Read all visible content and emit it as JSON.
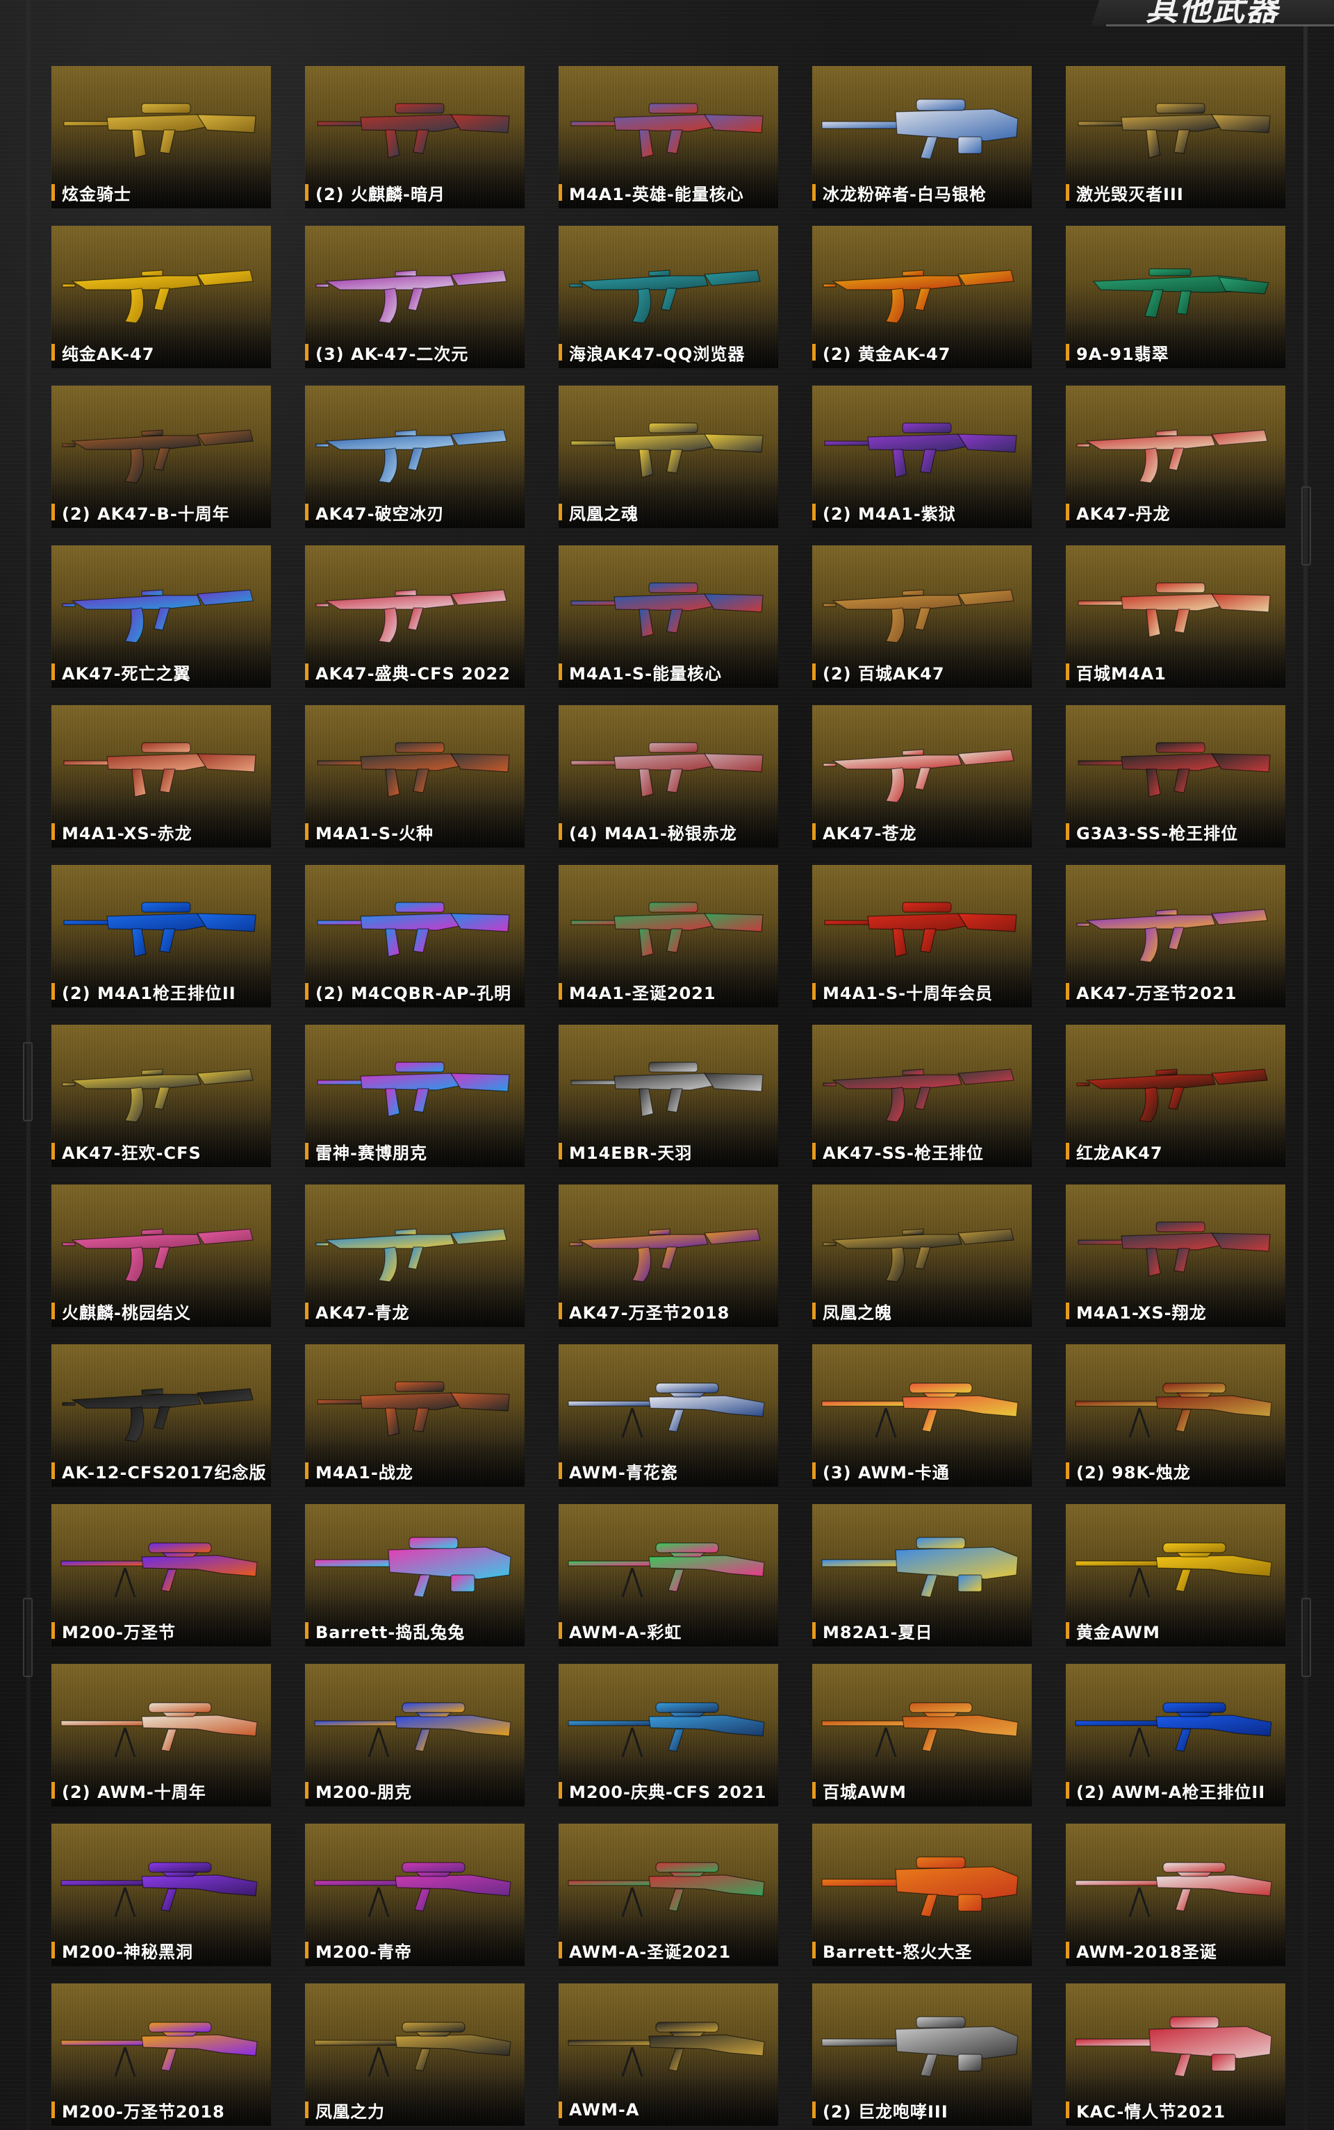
{
  "header": {
    "title": "其他武器"
  },
  "weapons": [
    {
      "name": "炫金骑士",
      "kind": "rifle",
      "colors": [
        "#d8b23a",
        "#8a6a18"
      ]
    },
    {
      "name": "(2) 火麒麟-暗月",
      "kind": "rifle",
      "colors": [
        "#b0332b",
        "#3a3a48"
      ]
    },
    {
      "name": "M4A1-英雄-能量核心",
      "kind": "rifle",
      "colors": [
        "#6a5aa8",
        "#c0392b"
      ]
    },
    {
      "name": "冰龙粉碎者-白马银枪",
      "kind": "heavy",
      "colors": [
        "#d8dce8",
        "#3a6ab0"
      ]
    },
    {
      "name": "激光毁灭者III",
      "kind": "rifle",
      "colors": [
        "#c8a040",
        "#2a2a2a"
      ]
    },
    {
      "name": "纯金AK-47",
      "kind": "ak",
      "colors": [
        "#f2c318",
        "#b88a08"
      ]
    },
    {
      "name": "(3) AK-47-二次元",
      "kind": "ak",
      "colors": [
        "#a03aa8",
        "#d8c0e0"
      ]
    },
    {
      "name": "海浪AK47-QQ浏览器",
      "kind": "ak",
      "colors": [
        "#2a9aa0",
        "#1a5a60"
      ]
    },
    {
      "name": "(2) 黄金AK-47",
      "kind": "ak",
      "colors": [
        "#e8a010",
        "#c04010"
      ]
    },
    {
      "name": "9A-91翡翠",
      "kind": "smg",
      "colors": [
        "#2aa070",
        "#0e5a3a"
      ]
    },
    {
      "name": "(2) AK47-B-十周年",
      "kind": "ak",
      "colors": [
        "#a05a2a",
        "#2a2a2a"
      ]
    },
    {
      "name": "AK47-破空冰刃",
      "kind": "ak",
      "colors": [
        "#3a6ab0",
        "#a0c8e8"
      ]
    },
    {
      "name": "凤凰之魂",
      "kind": "rifle",
      "colors": [
        "#e8c83a",
        "#3a3a3a"
      ]
    },
    {
      "name": "(2) M4A1-紫狱",
      "kind": "rifle",
      "colors": [
        "#8a3ac8",
        "#3a2a6a"
      ]
    },
    {
      "name": "AK47-丹龙",
      "kind": "ak",
      "colors": [
        "#c83a3a",
        "#e8d0b0"
      ]
    },
    {
      "name": "AK47-死亡之翼",
      "kind": "ak",
      "colors": [
        "#6a3ac8",
        "#2a9ad8"
      ]
    },
    {
      "name": "AK47-盛典-CFS 2022",
      "kind": "ak",
      "colors": [
        "#c83a4a",
        "#e8c8d0"
      ]
    },
    {
      "name": "M4A1-S-能量核心",
      "kind": "rifle",
      "colors": [
        "#2a5ab0",
        "#c83a3a"
      ]
    },
    {
      "name": "(2) 百城AK47",
      "kind": "ak",
      "colors": [
        "#c8903a",
        "#8a5a2a"
      ]
    },
    {
      "name": "百城M4A1",
      "kind": "rifle",
      "colors": [
        "#c83a2a",
        "#e8d0a0"
      ]
    },
    {
      "name": "M4A1-XS-赤龙",
      "kind": "rifle",
      "colors": [
        "#a03a2a",
        "#e8a07a"
      ]
    },
    {
      "name": "M4A1-S-火种",
      "kind": "rifle",
      "colors": [
        "#3a3a3a",
        "#c85a2a"
      ]
    },
    {
      "name": "(4) M4A1-秘银赤龙",
      "kind": "rifle",
      "colors": [
        "#c8a0a8",
        "#a03a3a"
      ]
    },
    {
      "name": "AK47-苍龙",
      "kind": "ak",
      "colors": [
        "#e8e0d0",
        "#c83a3a"
      ]
    },
    {
      "name": "G3A3-SS-枪王排位",
      "kind": "rifle",
      "colors": [
        "#2a2a2a",
        "#c83a3a"
      ]
    },
    {
      "name": "(2) M4A1枪王排位II",
      "kind": "rifle",
      "colors": [
        "#1a6ae8",
        "#0a3aa0"
      ]
    },
    {
      "name": "(2) M4CQBR-AP-孔明",
      "kind": "rifle",
      "colors": [
        "#2a8ae8",
        "#c83ac8"
      ]
    },
    {
      "name": "M4A1-圣诞2021",
      "kind": "rifle",
      "colors": [
        "#3aa05a",
        "#c83a3a"
      ]
    },
    {
      "name": "M4A1-S-十周年会员",
      "kind": "rifle",
      "colors": [
        "#d82a1a",
        "#8a1a10"
      ]
    },
    {
      "name": "AK47-万圣节2021",
      "kind": "ak",
      "colors": [
        "#8a3ac8",
        "#e8a03a"
      ]
    },
    {
      "name": "AK47-狂欢-CFS",
      "kind": "ak",
      "colors": [
        "#e8c83a",
        "#3a3a3a"
      ]
    },
    {
      "name": "雷神-赛博朋克",
      "kind": "rifle",
      "colors": [
        "#c83ac8",
        "#2a9ae8"
      ]
    },
    {
      "name": "M14EBR-天羽",
      "kind": "rifle",
      "colors": [
        "#3a3a3a",
        "#c8c8c8"
      ]
    },
    {
      "name": "AK47-SS-枪王排位",
      "kind": "ak",
      "colors": [
        "#3a3a3a",
        "#c83a4a"
      ]
    },
    {
      "name": "红龙AK47",
      "kind": "ak",
      "colors": [
        "#c82a1a",
        "#3a1a10"
      ]
    },
    {
      "name": "火麒麟-桃园结义",
      "kind": "ak",
      "colors": [
        "#e85aa0",
        "#a03a6a"
      ]
    },
    {
      "name": "AK47-青龙",
      "kind": "ak",
      "colors": [
        "#2a8ad8",
        "#e8c83a"
      ]
    },
    {
      "name": "AK47-万圣节2018",
      "kind": "ak",
      "colors": [
        "#e89a1a",
        "#6a2aa0"
      ]
    },
    {
      "name": "凤凰之魄",
      "kind": "ak",
      "colors": [
        "#c8a03a",
        "#2a2a2a"
      ]
    },
    {
      "name": "M4A1-XS-翔龙",
      "kind": "rifle",
      "colors": [
        "#3a3a4a",
        "#c83a3a"
      ]
    },
    {
      "name": "AK-12-CFS2017纪念版",
      "kind": "ak",
      "colors": [
        "#1a1a1a",
        "#3a3a3a"
      ]
    },
    {
      "name": "M4A1-战龙",
      "kind": "rifle",
      "colors": [
        "#c85a2a",
        "#2a2a2a"
      ]
    },
    {
      "name": "AWM-青花瓷",
      "kind": "sniper",
      "colors": [
        "#e8e8f0",
        "#2a4a8a"
      ]
    },
    {
      "name": "(3) AWM-卡通",
      "kind": "sniper",
      "colors": [
        "#e85a3a",
        "#e8c83a"
      ]
    },
    {
      "name": "(2) 98K-烛龙",
      "kind": "sniper",
      "colors": [
        "#8a2a1a",
        "#c8a03a"
      ]
    },
    {
      "name": "M200-万圣节",
      "kind": "sniper",
      "colors": [
        "#6a2ae8",
        "#e85a1a"
      ]
    },
    {
      "name": "Barrett-捣乱兔兔",
      "kind": "heavy",
      "colors": [
        "#e83ab0",
        "#3ac8e8"
      ]
    },
    {
      "name": "AWM-A-彩虹",
      "kind": "sniper",
      "colors": [
        "#3ac85a",
        "#e83a8a"
      ]
    },
    {
      "name": "M82A1-夏日",
      "kind": "heavy",
      "colors": [
        "#3a8ae8",
        "#e8c83a"
      ]
    },
    {
      "name": "黄金AWM",
      "kind": "sniper",
      "colors": [
        "#f2c318",
        "#a07a08"
      ]
    },
    {
      "name": "(2) AWM-十周年",
      "kind": "sniper",
      "colors": [
        "#e8e0d0",
        "#c85a2a"
      ]
    },
    {
      "name": "M200-朋克",
      "kind": "sniper",
      "colors": [
        "#2a4ae8",
        "#e8a01a"
      ]
    },
    {
      "name": "M200-庆典-CFS 2021",
      "kind": "sniper",
      "colors": [
        "#3a9ad8",
        "#1a3a6a"
      ]
    },
    {
      "name": "百城AWM",
      "kind": "sniper",
      "colors": [
        "#c85a1a",
        "#e8a03a"
      ]
    },
    {
      "name": "(2) AWM-A枪王排位II",
      "kind": "sniper",
      "colors": [
        "#1a5ae8",
        "#0a2a8a"
      ]
    },
    {
      "name": "M200-神秘黑洞",
      "kind": "sniper",
      "colors": [
        "#8a3ae8",
        "#3a1a6a"
      ]
    },
    {
      "name": "M200-青帝",
      "kind": "sniper",
      "colors": [
        "#c83ab0",
        "#6a2a8a"
      ]
    },
    {
      "name": "AWM-A-圣诞2021",
      "kind": "sniper",
      "colors": [
        "#c83a3a",
        "#3aa05a"
      ]
    },
    {
      "name": "Barrett-怒火大圣",
      "kind": "heavy",
      "colors": [
        "#e87a1a",
        "#c83a1a"
      ]
    },
    {
      "name": "AWM-2018圣诞",
      "kind": "sniper",
      "colors": [
        "#e8e0e0",
        "#c83a3a"
      ]
    },
    {
      "name": "M200-万圣节2018",
      "kind": "sniper",
      "colors": [
        "#e89a1a",
        "#8a2ae8"
      ]
    },
    {
      "name": "凤凰之力",
      "kind": "sniper",
      "colors": [
        "#c8a03a",
        "#2a2a2a"
      ]
    },
    {
      "name": "AWM-A",
      "kind": "sniper",
      "colors": [
        "#2a2a2a",
        "#c8a03a"
      ]
    },
    {
      "name": "(2) 巨龙咆哮III",
      "kind": "heavy",
      "colors": [
        "#c8c8c8",
        "#3a3a3a"
      ]
    },
    {
      "name": "KAC-情人节2021",
      "kind": "heavy",
      "colors": [
        "#c82a3a",
        "#e8c8c8"
      ]
    }
  ]
}
